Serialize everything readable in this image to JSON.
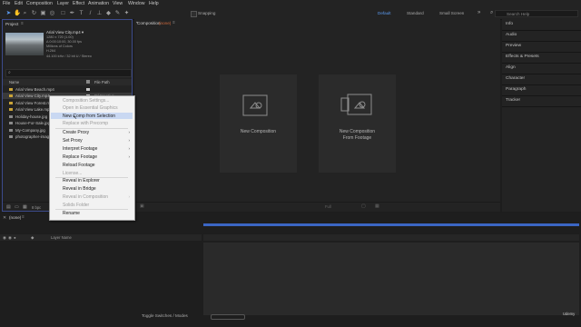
{
  "menubar": {
    "items": [
      "File",
      "Edit",
      "Composition",
      "Layer",
      "Effect",
      "Animation",
      "View",
      "Window",
      "Help"
    ]
  },
  "toolbar": {
    "snapping_label": "Snapping",
    "workspaces": [
      "Default",
      "Standard",
      "Small Screen"
    ],
    "search_placeholder": "Search Help"
  },
  "project": {
    "title": "Project",
    "selected_name": "Arial View City.mp4 ▾",
    "meta": [
      "1280 x 720 (1.00)",
      "Δ 0:00:10:00, 30.00 fps",
      "Millions of Colors",
      "H.264",
      "44.100 kHz / 32 bit U / Stereo"
    ],
    "search_icon_label": "⌕",
    "columns": {
      "name": "Name",
      "file_path": "File Path"
    },
    "files": [
      {
        "name": "Arial View Beach.mp4",
        "path": "",
        "tag": "#c8c8c8"
      },
      {
        "name": "Arial View City.mp4",
        "path": "D:\\Creative",
        "tag": "#c8c8c8"
      },
      {
        "name": "Arial View Forest.m",
        "path": "",
        "tag": "#c8c8c8"
      },
      {
        "name": "Arial View Lake.mp",
        "path": "",
        "tag": "#c8c8c8"
      },
      {
        "name": "Holiday-house.jpg",
        "path": "",
        "tag": "#c0a5c5"
      },
      {
        "name": "House-For-Sale.jpg",
        "path": "",
        "tag": "#c0a5c5"
      },
      {
        "name": "My-Company.jpg",
        "path": "",
        "tag": "#c0a5c5"
      },
      {
        "name": "photographer-image",
        "path": "",
        "tag": "#c0a5c5"
      }
    ],
    "bpc": "8 bpc"
  },
  "composition": {
    "tab": "Composition",
    "tab_name": "(none)",
    "cards": [
      "New Composition",
      "New Composition\nFrom Footage"
    ],
    "zoom_hint": "Full"
  },
  "right_panel": {
    "items": [
      "Info",
      "Audio",
      "Preview",
      "Effects & Presets",
      "Align",
      "Character",
      "Paragraph",
      "Tracker"
    ]
  },
  "timeline": {
    "tab": "(none)",
    "layer_name_header": "Layer Name",
    "toggle_label": "Toggle Switches / Modes",
    "watermark": "Udemy"
  },
  "context_menu": {
    "items": [
      {
        "label": "Composition Settings...",
        "enabled": false,
        "submenu": false
      },
      {
        "label": "Open in Essential Graphics",
        "enabled": false,
        "submenu": false
      },
      {
        "label": "New Comp from Selection",
        "enabled": true,
        "submenu": false,
        "highlighted": true
      },
      {
        "label": "Replace with Precomp",
        "enabled": false,
        "submenu": false
      },
      {
        "label": "Create Proxy",
        "enabled": true,
        "submenu": true
      },
      {
        "label": "Set Proxy",
        "enabled": true,
        "submenu": true
      },
      {
        "label": "Interpret Footage",
        "enabled": true,
        "submenu": true
      },
      {
        "label": "Replace Footage",
        "enabled": true,
        "submenu": true
      },
      {
        "label": "Reload Footage",
        "enabled": true,
        "submenu": false
      },
      {
        "label": "License...",
        "enabled": false,
        "submenu": false
      },
      {
        "label": "Reveal in Explorer",
        "enabled": true,
        "submenu": false
      },
      {
        "label": "Reveal in Bridge",
        "enabled": true,
        "submenu": false
      },
      {
        "label": "Reveal in Composition",
        "enabled": false,
        "submenu": true
      },
      {
        "label": "Solids Folder",
        "enabled": false,
        "submenu": false
      },
      {
        "label": "Rename",
        "enabled": true,
        "submenu": false
      }
    ]
  },
  "colors": {
    "accent_blue": "#2b68d9",
    "panel_border": "#3c4b8c",
    "menu_highlight": "#c9d8f2"
  }
}
